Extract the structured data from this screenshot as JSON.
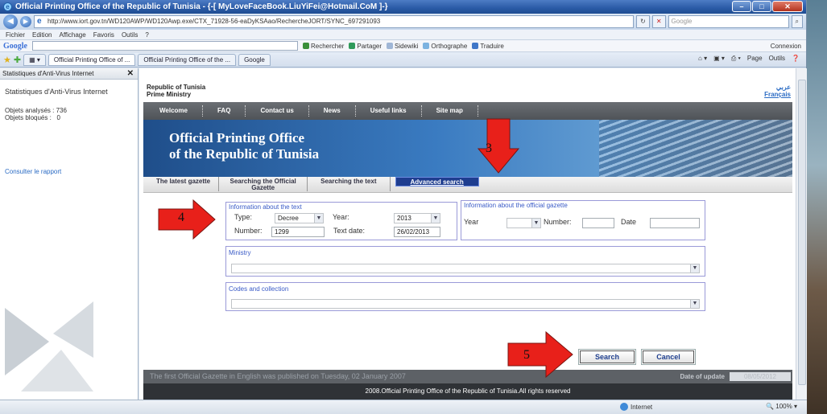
{
  "window": {
    "title": "Official Printing Office of the Republic of Tunisia -  {-[ MyLoveFaceBook.LiuYiFei@Hotmail.CoM ]-}"
  },
  "address": {
    "url": "http://www.iort.gov.tn/WD120AWP/WD120Awp.exe/CTX_71928-56-eaDyKSAao/RechercheJORT/SYNC_697291093",
    "search_placeholder": "Google"
  },
  "menu": [
    "Fichier",
    "Edition",
    "Affichage",
    "Favoris",
    "Outils",
    "?"
  ],
  "google_toolbar": {
    "logo": "Google",
    "items": [
      "Rechercher",
      "Partager",
      "Sidewiki",
      "Orthographe",
      "Traduire"
    ],
    "connexion": "Connexion"
  },
  "tabs": [
    {
      "label": "Official Printing Office of ..."
    },
    {
      "label": "Official Printing Office of the ..."
    },
    {
      "label": "Google"
    }
  ],
  "command_bar": [
    "Page",
    "Outils"
  ],
  "sidebar": {
    "header": "Statistiques d'Anti-Virus Internet",
    "title": "Statistiques d'Anti-Virus Internet",
    "stats": [
      {
        "label": "Objets analysés :",
        "value": "736"
      },
      {
        "label": "Objets bloqués :",
        "value": "0"
      }
    ],
    "link": "Consulter le rapport"
  },
  "site": {
    "republic": "Republic of Tunisia",
    "ministry": "Prime Ministry",
    "lang_arabic": "عربي",
    "lang_french": "Français",
    "nav": [
      "Welcome",
      "FAQ",
      "Contact us",
      "News",
      "Useful links",
      "Site map"
    ],
    "banner_line1": "Official Printing Office",
    "banner_line2": "of the Republic of Tunisia",
    "tabs": [
      "The latest gazette",
      "Searching the Official Gazette",
      "Searching the text",
      "Advanced search"
    ]
  },
  "form": {
    "text_box_title": "Information about the text",
    "type_label": "Type:",
    "type_value": "Decree",
    "year_label": "Year:",
    "year_value": "2013",
    "number_label": "Number:",
    "number_value": "1299",
    "textdate_label": "Text date:",
    "textdate_value": "26/02/2013",
    "gazette_box_title": "Information about the official gazette",
    "g_year_label": "Year",
    "g_number_label": "Number:",
    "g_date_label": "Date",
    "ministry_title": "Ministry",
    "codes_title": "Codes and collection",
    "search_button": "Search",
    "cancel_button": "Cancel"
  },
  "footer": {
    "notice": "The first Official Gazette in English was published on Tuesday, 02 January 2007",
    "update_label": "Date of update",
    "update_value": "08/05/2012",
    "copyright": "2008.Official Printing Office of the Republic of Tunisia.All rights reserved"
  },
  "status": {
    "zone": "Internet",
    "zoom": "100%"
  },
  "annotations": [
    {
      "number": "3"
    },
    {
      "number": "4"
    },
    {
      "number": "5"
    }
  ],
  "colors": {
    "annotation_red": "#e8201a",
    "advanced_tab": "#1e3d8f",
    "nav_bar": "#5b5f64",
    "banner_blue": "#2f6bb0"
  }
}
